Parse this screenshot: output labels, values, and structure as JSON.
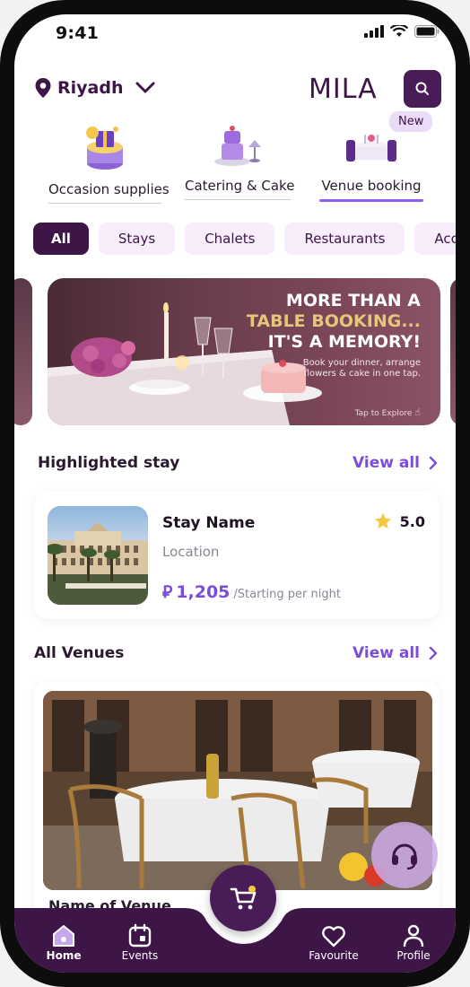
{
  "status_bar": {
    "time": "9:41"
  },
  "header": {
    "location": "Riyadh",
    "logo_text": "MILA"
  },
  "categories": [
    {
      "label": "Occasion supplies"
    },
    {
      "label": "Catering & Cake"
    },
    {
      "label": "Venue booking",
      "badge": "New"
    }
  ],
  "filters": [
    "All",
    "Stays",
    "Chalets",
    "Restaurants",
    "Accomm"
  ],
  "banner": {
    "line1": "MORE THAN A",
    "line2": "TABLE BOOKING...",
    "line3": "IT'S A MEMORY!",
    "sub1": "Book your dinner, arrange",
    "sub2": "flowers & cake in one tap.",
    "tap": "Tap to Explore"
  },
  "highlighted": {
    "title": "Highlighted stay",
    "view_all": "View all",
    "name": "Stay Name",
    "location": "Location",
    "currency": "⃁",
    "price": "1,205",
    "price_note": "/Starting per night",
    "rating": "5.0"
  },
  "venues": {
    "title": "All Venues",
    "view_all": "View all",
    "name": "Name of Venue"
  },
  "nav": {
    "home": "Home",
    "events": "Events",
    "favourite": "Favourite",
    "profile": "Profile"
  },
  "colors": {
    "primary": "#3d1547",
    "accent": "#7c4ddb",
    "chip_bg": "#f8eefb"
  }
}
